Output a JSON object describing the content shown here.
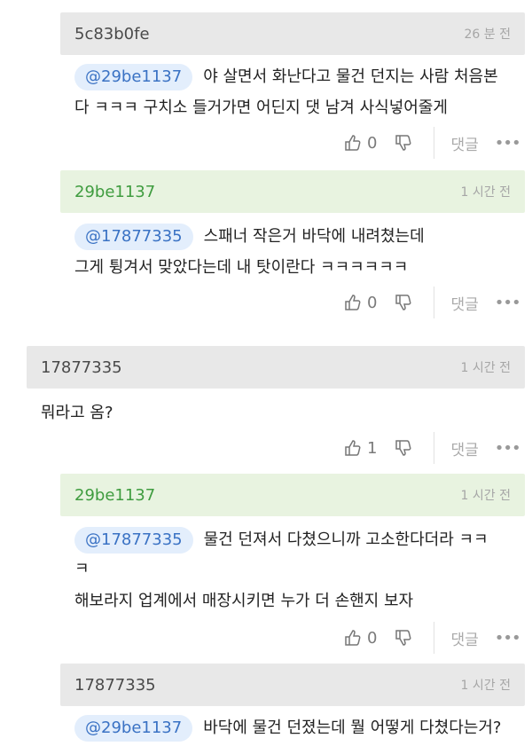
{
  "comments": [
    {
      "author": "5c83b0fe",
      "time": "26 분 전",
      "mention": "@29be1137",
      "lines": [
        "야 살면서 화난다고 물건 던지는 사람 처음본",
        "다 ㅋㅋㅋ 구치소 들거가면 어딘지 댓 남겨 사식넣어줄게"
      ],
      "likes": "0",
      "reply_label": "댓글"
    },
    {
      "author": "29be1137",
      "time": "1 시간 전",
      "mention": "@17877335",
      "lines": [
        "스패너 작은거 바닥에 내려쳤는데",
        "그게 튕겨서 맞았다는데 내 탓이란다 ㅋㅋㅋㅋㅋㅋ"
      ],
      "likes": "0",
      "reply_label": "댓글"
    },
    {
      "author": "17877335",
      "time": "1 시간 전",
      "lines": [
        "뭐라고 옴?"
      ],
      "likes": "1",
      "reply_label": "댓글"
    },
    {
      "author": "29be1137",
      "time": "1 시간 전",
      "mention": "@17877335",
      "lines": [
        "물건 던져서 다쳤으니까 고소한다더라 ㅋㅋ",
        "ㅋ",
        "해보라지 업계에서 매장시키면 누가 더 손핸지 보자"
      ],
      "likes": "0",
      "reply_label": "댓글"
    },
    {
      "author": "17877335",
      "time": "1 시간 전",
      "mention": "@29be1137",
      "lines": [
        "바닥에 물건 던졌는데 뭘 어떻게 다쳤다는거?"
      ]
    }
  ],
  "more_icon": "more-dots-icon",
  "like_icon": "thumbs-up-icon",
  "dislike_icon": "thumbs-down-icon",
  "colors": {
    "mention_bg": "#e3eefc",
    "mention_text": "#3a72c4",
    "green_header": "#e8f3e0",
    "gray_header": "#e8e8e8",
    "green_author": "#3f9c3f"
  }
}
